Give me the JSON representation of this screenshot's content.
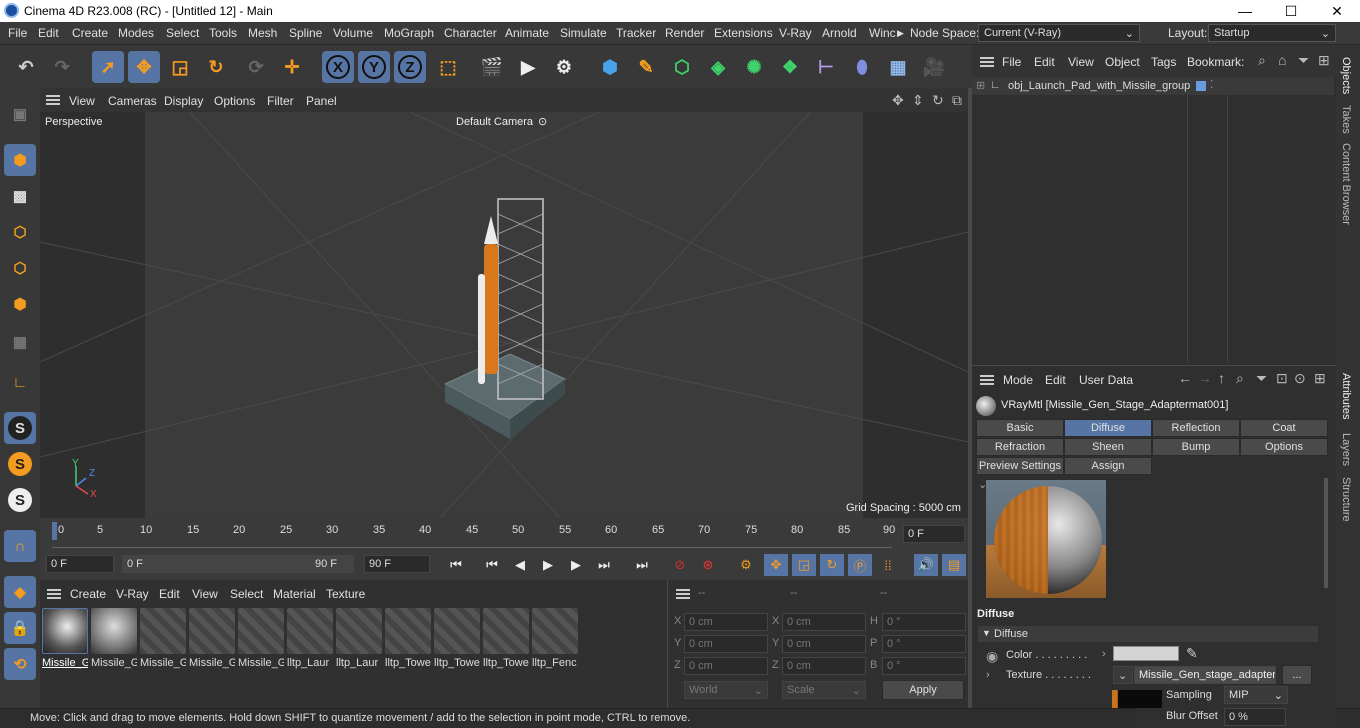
{
  "window": {
    "title": "Cinema 4D R23.008 (RC) - [Untitled 12] - Main",
    "minimize": "—",
    "maximize": "☐",
    "close": "✕"
  },
  "menu": {
    "items": [
      "File",
      "Edit",
      "Create",
      "Modes",
      "Select",
      "Tools",
      "Mesh",
      "Spline",
      "Volume",
      "MoGraph",
      "Character",
      "Animate",
      "Simulate",
      "Tracker",
      "Render",
      "Extensions",
      "V-Ray",
      "Arnold",
      "Winc"
    ],
    "node_space_label": "Node Space:",
    "node_space_value": "Current (V-Ray)",
    "layout_label": "Layout:",
    "layout_value": "Startup"
  },
  "viewport": {
    "menu": [
      "View",
      "Cameras",
      "Display",
      "Options",
      "Filter",
      "Panel"
    ],
    "view_name": "Perspective",
    "camera": "Default Camera",
    "grid_spacing": "Grid Spacing : 5000 cm",
    "axis_labels": {
      "y": "Y",
      "z": "Z",
      "x": "X"
    }
  },
  "timeline": {
    "ticks": [
      "0",
      "5",
      "10",
      "15",
      "20",
      "25",
      "30",
      "35",
      "40",
      "45",
      "50",
      "55",
      "60",
      "65",
      "70",
      "75",
      "80",
      "85",
      "90"
    ],
    "current_frame": "0 F"
  },
  "playback": {
    "start": "0 F",
    "range_start": "0 F",
    "range_end": "90 F",
    "end": "90 F"
  },
  "materials": {
    "menu": [
      "Create",
      "V-Ray",
      "Edit",
      "View",
      "Select",
      "Material",
      "Texture"
    ],
    "items": [
      "Missile_G",
      "Missile_G",
      "Missile_G",
      "Missile_G",
      "Missile_G",
      "lltp_Laur",
      "lltp_Laur",
      "lltp_Towe",
      "lltp_Towe",
      "lltp_Towe",
      "lltp_Fenc"
    ]
  },
  "coords": {
    "headers": [
      "--",
      "--",
      "--"
    ],
    "rows": [
      {
        "a": "X",
        "av": "0 cm",
        "b": "X",
        "bv": "0 cm",
        "c": "H",
        "cv": "0 °"
      },
      {
        "a": "Y",
        "av": "0 cm",
        "b": "Y",
        "bv": "0 cm",
        "c": "P",
        "cv": "0 °"
      },
      {
        "a": "Z",
        "av": "0 cm",
        "b": "Z",
        "bv": "0 cm",
        "c": "B",
        "cv": "0 °"
      }
    ],
    "world": "World",
    "scale": "Scale",
    "apply": "Apply"
  },
  "objects": {
    "menu": [
      "File",
      "Edit",
      "View",
      "Object",
      "Tags",
      "Bookmark:"
    ],
    "tree": [
      {
        "label": "obj_Launch_Pad_with_Missile_group"
      }
    ]
  },
  "attributes": {
    "menu": [
      "Mode",
      "Edit",
      "User Data"
    ],
    "material_name": "VRayMtl [Missile_Gen_Stage_Adaptermat001]",
    "tabs_row1": [
      "Basic",
      "Diffuse",
      "Reflection",
      "Coat"
    ],
    "tabs_row2": [
      "Refraction",
      "Sheen",
      "Bump",
      "Options"
    ],
    "tabs_row3": [
      "Preview Settings",
      "Assign"
    ],
    "section": "Diffuse",
    "subsection": "Diffuse",
    "color_label": "Color . . . . . . . . .",
    "texture_label": "Texture . . . . . . . .",
    "texture_value": "Missile_Gen_stage_adapter_",
    "texture_more": "...",
    "sampling_label": "Sampling",
    "sampling_value": "MIP",
    "blur_label": "Blur Offset",
    "blur_value": "0 %"
  },
  "side_tabs": [
    "Objects",
    "Takes",
    "Content Browser",
    "Attributes",
    "Layers",
    "Structure"
  ],
  "status": "Move: Click and drag to move elements. Hold down SHIFT to quantize movement / add to the selection in point mode, CTRL to remove.",
  "colors": {
    "accent": "#5675a5",
    "orange": "#d8771c",
    "bg": "#3a3a3a"
  }
}
